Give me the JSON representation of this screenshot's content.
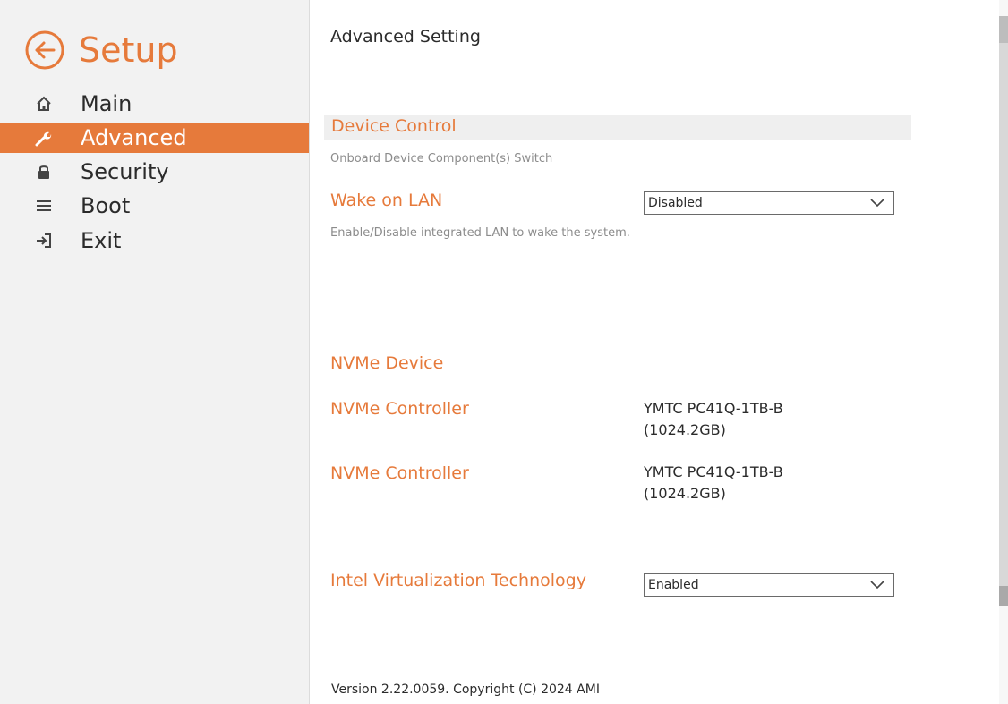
{
  "colors": {
    "accent": "#e67a3b",
    "sidebar_bg": "#f2f2f2",
    "text": "#2b2b2b",
    "muted": "#8c8c8c"
  },
  "sidebar": {
    "title": "Setup",
    "back_icon": "arrow-left-circle-icon",
    "items": [
      {
        "label": "Main",
        "icon": "home-icon",
        "active": false
      },
      {
        "label": "Advanced",
        "icon": "wrench-icon",
        "active": true
      },
      {
        "label": "Security",
        "icon": "lock-icon",
        "active": false
      },
      {
        "label": "Boot",
        "icon": "drive-icon",
        "active": false
      },
      {
        "label": "Exit",
        "icon": "exit-icon",
        "active": false
      }
    ]
  },
  "main": {
    "title": "Advanced Setting",
    "device_control": {
      "heading": "Device Control",
      "description": "Onboard Device Component(s) Switch"
    },
    "wake_on_lan": {
      "label": "Wake on LAN",
      "value": "Disabled",
      "description": "Enable/Disable integrated LAN to wake the system."
    },
    "nvme": {
      "heading": "NVMe Device",
      "controllers": [
        {
          "label": "NVMe Controller",
          "model": "YMTC PC41Q-1TB-B",
          "capacity": "(1024.2GB)"
        },
        {
          "label": "NVMe Controller",
          "model": "YMTC PC41Q-1TB-B",
          "capacity": "(1024.2GB)"
        }
      ]
    },
    "virtualization": {
      "label": "Intel Virtualization Technology",
      "value": "Enabled"
    }
  },
  "footer": {
    "text": "Version 2.22.0059. Copyright (C) 2024 AMI"
  }
}
